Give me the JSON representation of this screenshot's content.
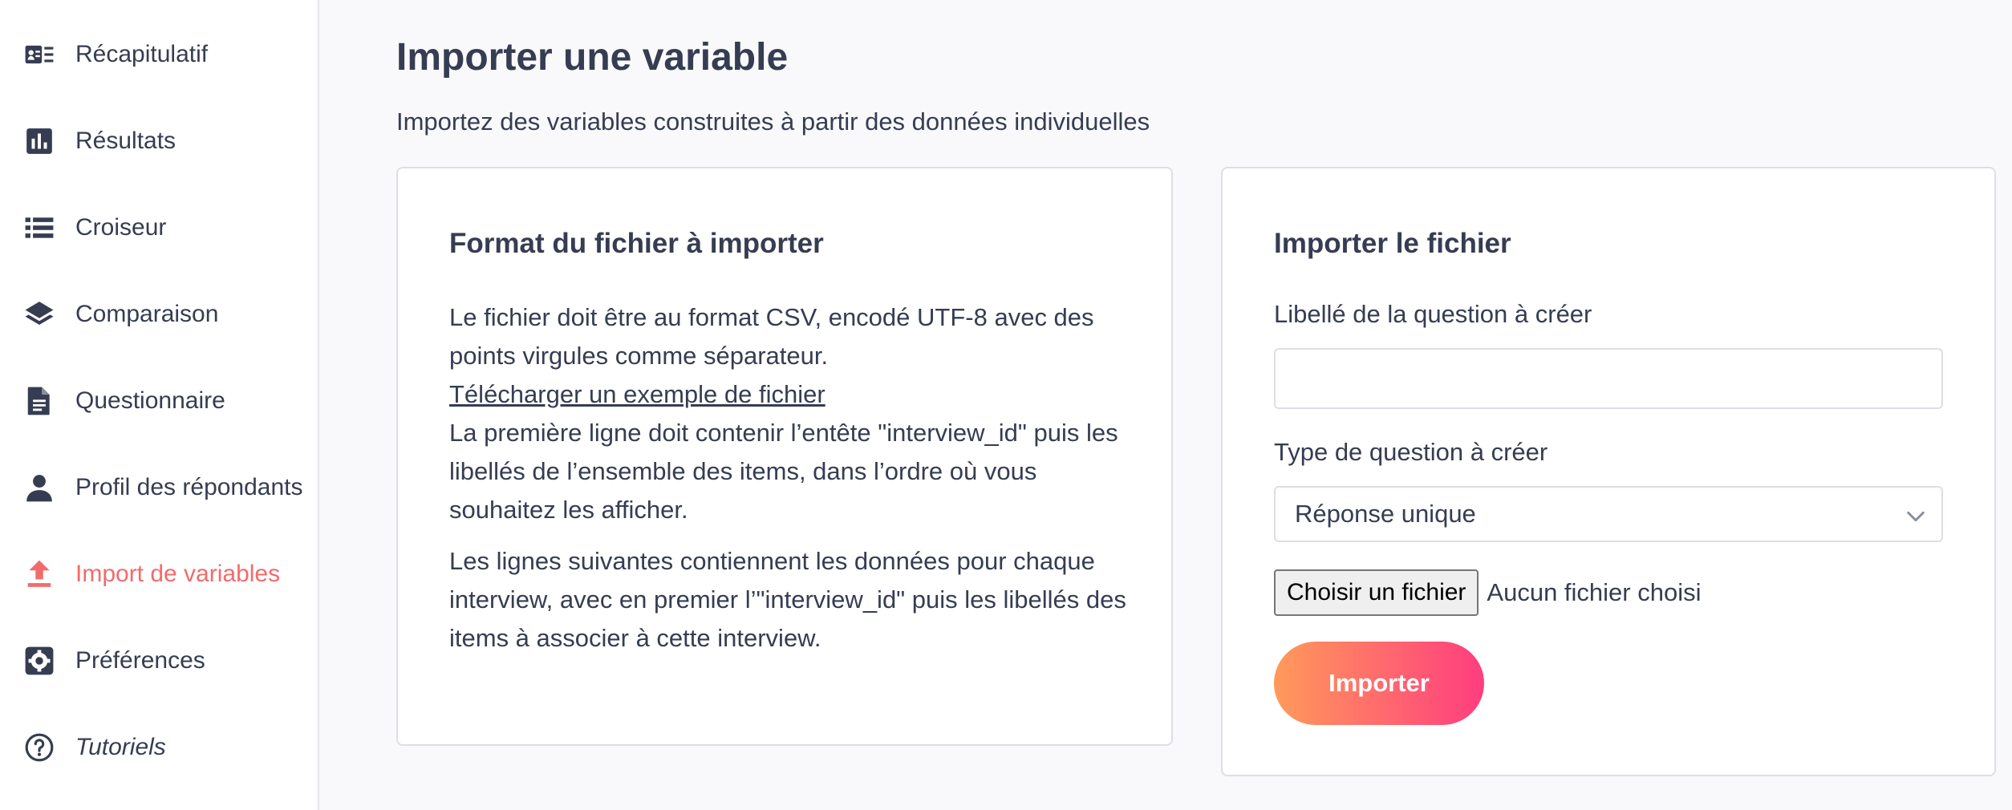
{
  "sidebar": {
    "items": [
      {
        "label": "Récapitulatif",
        "icon": "id-card-icon"
      },
      {
        "label": "Résultats",
        "icon": "bar-chart-icon"
      },
      {
        "label": "Croiseur",
        "icon": "list-icon"
      },
      {
        "label": "Comparaison",
        "icon": "layers-icon"
      },
      {
        "label": "Questionnaire",
        "icon": "document-icon"
      },
      {
        "label": "Profil des répondants",
        "icon": "person-icon"
      },
      {
        "label": "Import de variables",
        "icon": "upload-icon",
        "active": true
      },
      {
        "label": "Préférences",
        "icon": "gear-icon"
      },
      {
        "label": "Tutoriels",
        "icon": "help-circle-icon"
      }
    ]
  },
  "page": {
    "title": "Importer une variable",
    "subtitle": "Importez des variables construites à partir des données individuelles"
  },
  "format_card": {
    "title": "Format du fichier à importer",
    "para1": "Le fichier doit être au format CSV, encodé UTF-8 avec des points virgules comme séparateur.",
    "download_link": "Télécharger un exemple de fichier",
    "para2": "La première ligne doit contenir l’entête \"interview_id\" puis les libellés de l’ensemble des items, dans l’ordre où vous souhaitez les afficher.",
    "para3": "Les lignes suivantes contiennent les données pour chaque interview, avec en premier l’\"interview_id\" puis les libellés des items à associer à cette interview."
  },
  "import_card": {
    "title": "Importer le fichier",
    "question_label": "Libellé de la question à créer",
    "question_value": "",
    "type_label": "Type de question à créer",
    "type_value": "Réponse unique",
    "file_button": "Choisir un fichier",
    "file_status": "Aucun fichier choisi",
    "submit": "Importer"
  },
  "colors": {
    "active": "#f26b6b",
    "text": "#363d52",
    "button_gradient_start": "#ff9a5a",
    "button_gradient_end": "#ff3d7f"
  }
}
